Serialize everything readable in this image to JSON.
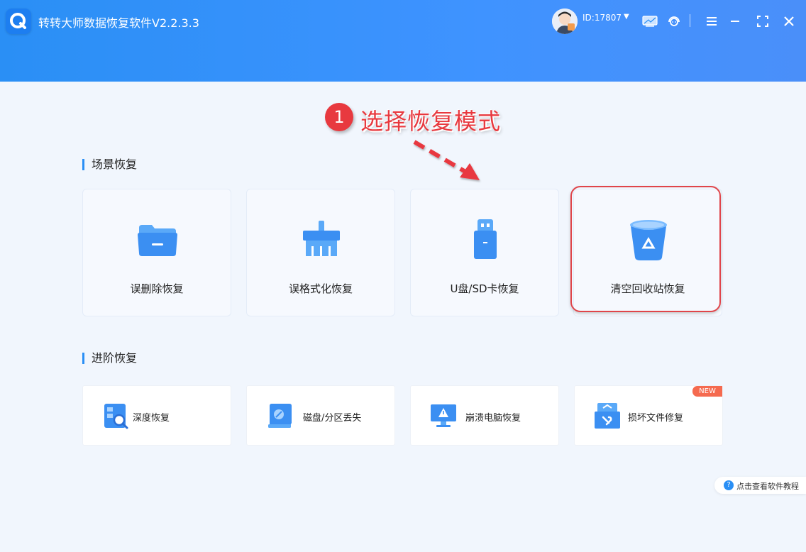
{
  "window": {
    "title": "转转大师数据恢复软件V2.2.3.3",
    "user_id": "ID:17807"
  },
  "annotation": {
    "step_number": "1",
    "text": "选择恢复模式"
  },
  "scene_section": {
    "title": "场景恢复",
    "cards": [
      {
        "label": "误删除恢复",
        "icon": "folder-icon"
      },
      {
        "label": "误格式化恢复",
        "icon": "brush-icon"
      },
      {
        "label": "U盘/SD卡恢复",
        "icon": "usb-drive-icon"
      },
      {
        "label": "清空回收站恢复",
        "icon": "recycle-bin-icon",
        "highlighted": true
      }
    ]
  },
  "advanced_section": {
    "title": "进阶恢复",
    "cards": [
      {
        "label": "深度恢复",
        "icon": "deep-scan-icon"
      },
      {
        "label": "磁盘/分区丢失",
        "icon": "disk-icon"
      },
      {
        "label": "崩溃电脑恢复",
        "icon": "crashed-monitor-icon"
      },
      {
        "label": "损坏文件修复",
        "icon": "file-repair-icon",
        "badge": "NEW"
      }
    ]
  },
  "tutorial": {
    "icon_text": "?",
    "label": "点击查看软件教程"
  },
  "colors": {
    "header_blue": "#2a8ff5",
    "annotation_red": "#e8393f",
    "page_bg": "#f1f6fd"
  }
}
